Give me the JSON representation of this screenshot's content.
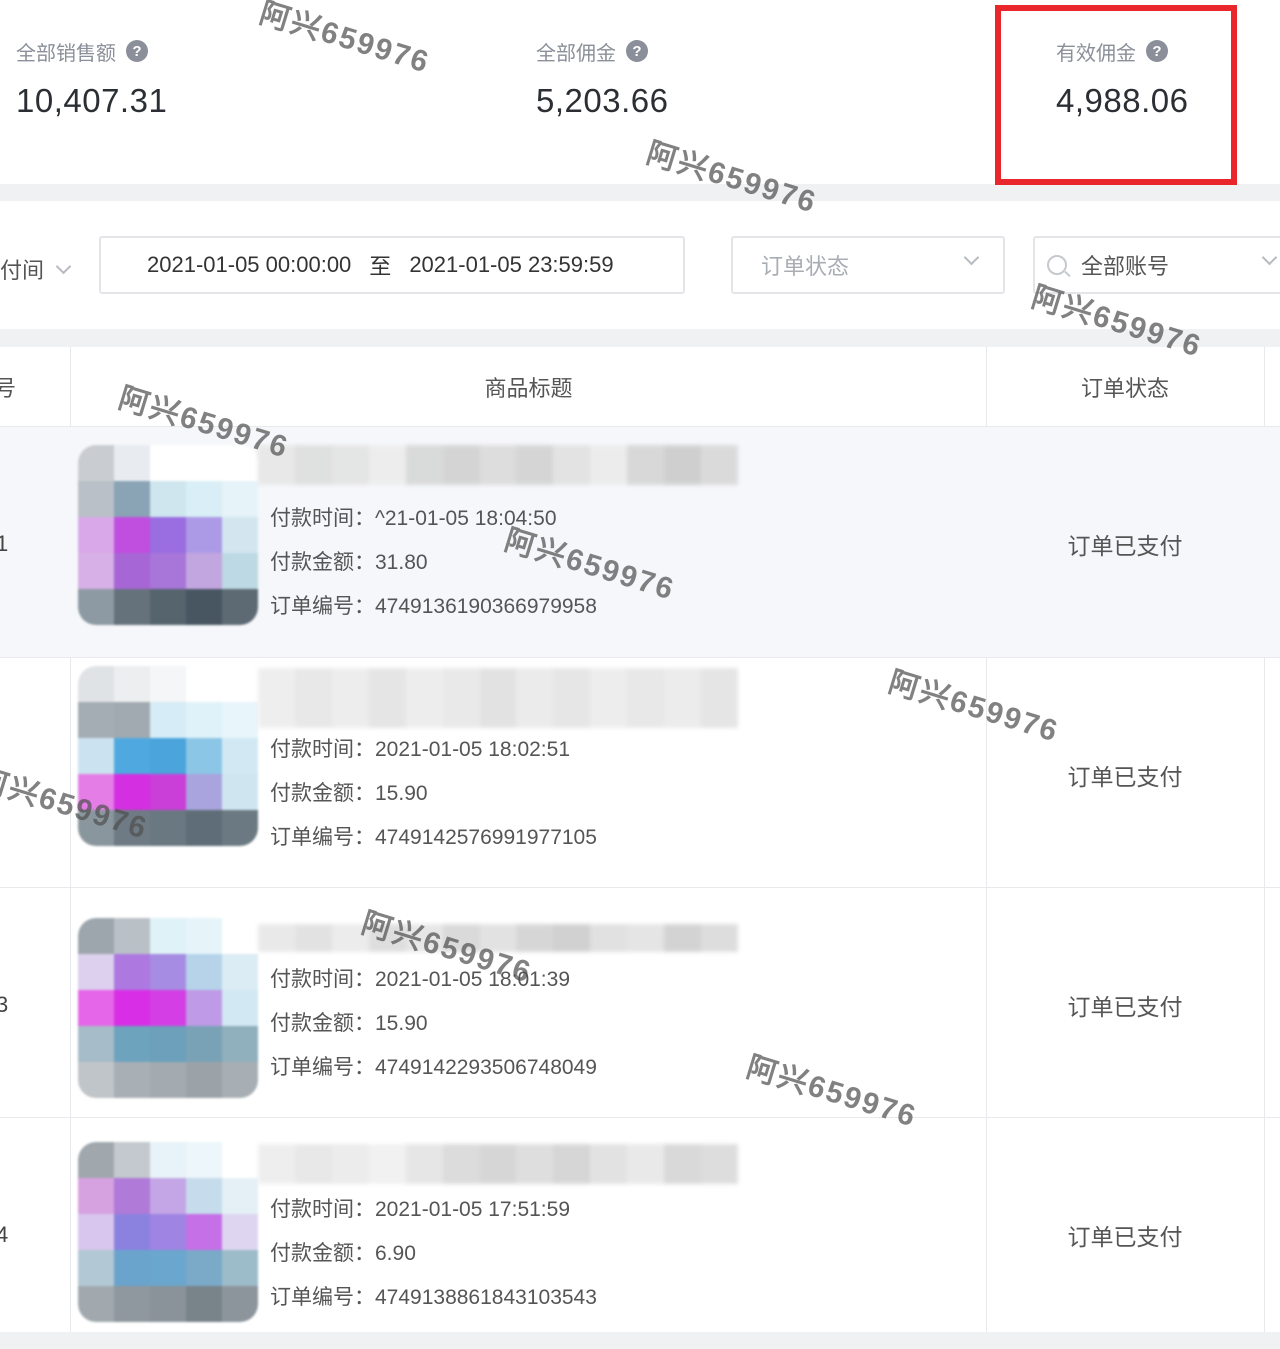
{
  "stats": [
    {
      "label": "全部销售额",
      "value": "10,407.31"
    },
    {
      "label": "全部佣金",
      "value": "5,203.66"
    },
    {
      "label": "有效佣金",
      "value": "4,988.06"
    }
  ],
  "filters": {
    "time_type": "付间",
    "date_start": "2021-01-05 00:00:00",
    "date_sep": "至",
    "date_end": "2021-01-05 23:59:59",
    "status_placeholder": "订单状态",
    "account_value": "全部账号"
  },
  "table": {
    "headers": {
      "index": "号",
      "title": "商品标题",
      "status": "订单状态"
    },
    "labels": {
      "pay_time": "付款时间：",
      "pay_amount": "付款金额：",
      "order_no": "订单编号："
    },
    "rows": [
      {
        "index": "1",
        "pay_time": "^21-01-05 18:04:50",
        "pay_amount": "31.80",
        "order_no": "4749136190366979958",
        "status": "订单已支付"
      },
      {
        "index": "",
        "pay_time": "2021-01-05 18:02:51",
        "pay_amount": "15.90",
        "order_no": "4749142576991977105",
        "status": "订单已支付"
      },
      {
        "index": "3",
        "pay_time": "2021-01-05 18:01:39",
        "pay_amount": "15.90",
        "order_no": "4749142293506748049",
        "status": "订单已支付"
      },
      {
        "index": "4",
        "pay_time": "2021-01-05 17:51:59",
        "pay_amount": "6.90",
        "order_no": "4749138861843103543",
        "status": "订单已支付"
      }
    ]
  },
  "watermark": "阿兴659976",
  "colors": {
    "highlight": "#e8262b",
    "label": "#8a8f99",
    "value": "#2b2e33"
  }
}
